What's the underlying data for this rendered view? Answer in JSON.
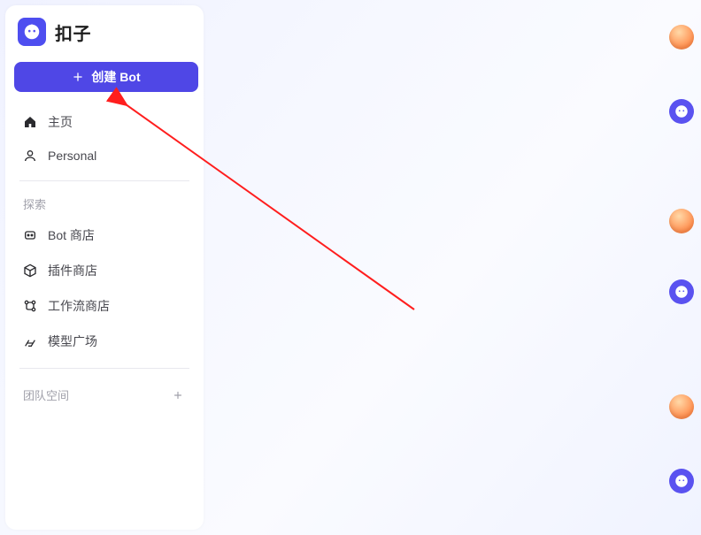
{
  "brand": {
    "name": "扣子"
  },
  "create_button": {
    "label": "创建 Bot"
  },
  "nav": {
    "home": "主页",
    "personal": "Personal"
  },
  "explore": {
    "section_label": "探索",
    "items": [
      {
        "label": "Bot 商店"
      },
      {
        "label": "插件商店"
      },
      {
        "label": "工作流商店"
      },
      {
        "label": "模型广场"
      }
    ]
  },
  "team": {
    "section_label": "团队空间"
  },
  "rail": {
    "items": [
      {
        "kind": "photo"
      },
      {
        "kind": "bot"
      },
      {
        "kind": "photo"
      },
      {
        "kind": "bot"
      },
      {
        "kind": "photo"
      },
      {
        "kind": "bot"
      }
    ]
  }
}
